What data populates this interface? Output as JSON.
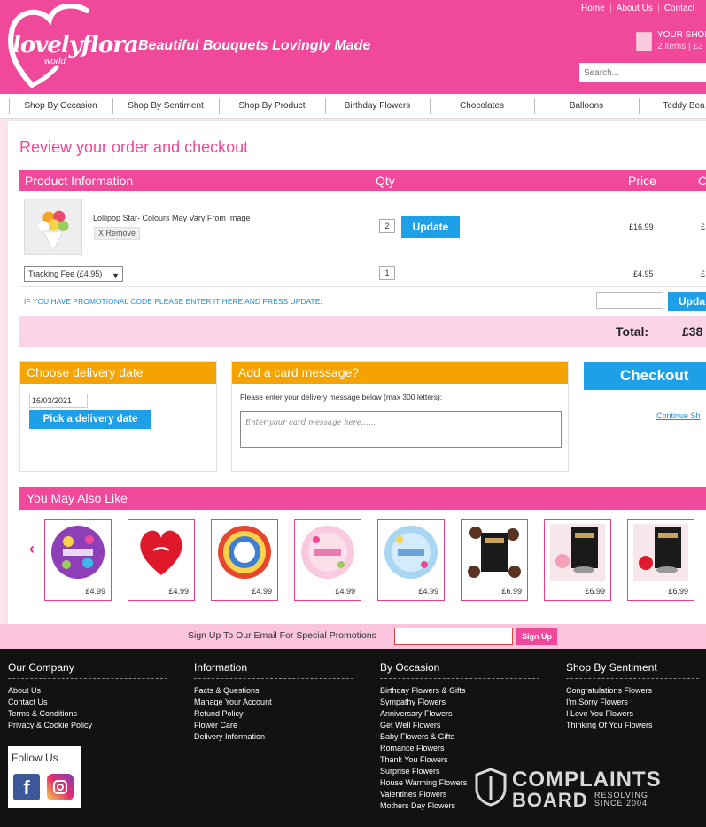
{
  "header": {
    "logo_text": "lovelyflora",
    "logo_sub": "world",
    "tagline": "Beautiful Bouquets Lovingly Made",
    "topnav": [
      "Home",
      "About Us",
      "Contact"
    ],
    "basket_title": "YOUR SHOP",
    "basket_items": "2 items  |  £3",
    "search_placeholder": "Search..."
  },
  "nav": [
    "Shop By Occasion",
    "Shop By Sentiment",
    "Shop By Product",
    "Birthday Flowers",
    "Chocolates",
    "Balloons",
    "Teddy Bea"
  ],
  "cart": {
    "page_title": "Review your order and checkout",
    "col_product": "Product Information",
    "col_qty": "Qty",
    "col_price": "Price",
    "col_total": "C",
    "product_name": "Lollipop Star- Colours May Vary From Image",
    "remove_label": "X Remove",
    "product_qty": "2",
    "update_label": "Update",
    "product_price": "£16.99",
    "product_total": "£",
    "tracking_label": "Tracking Fee (£4.95)",
    "tracking_qty": "1",
    "tracking_price": "£4.95",
    "tracking_total": "£",
    "promo_text": "IF YOU HAVE PROMOTIONAL CODE PLEASE ENTER IT HERE AND PRESS UPDATE:",
    "promo_update_label": "Upda",
    "total_label": "Total:",
    "total_value": "£38"
  },
  "delivery": {
    "heading": "Choose delivery date",
    "date_value": "16/03/2021",
    "pick_label": "Pick a delivery date"
  },
  "card_message": {
    "heading": "Add a card message?",
    "instructions": "Please enter your delivery message below (max 300 letters):",
    "placeholder": "Enter your card message here......"
  },
  "checkout": {
    "button_label": "Checkout",
    "continue_label": "Continue Sh"
  },
  "also_like": {
    "heading": "You May Also Like",
    "items": [
      {
        "name": "happy-birthday-balloon",
        "price": "£4.99"
      },
      {
        "name": "heart-balloon",
        "price": "£4.99"
      },
      {
        "name": "thank-you-balloon",
        "price": "£4.99"
      },
      {
        "name": "baby-girl-balloon",
        "price": "£4.99"
      },
      {
        "name": "baby-boy-balloon",
        "price": "£4.99"
      },
      {
        "name": "beechs-chocolates-1",
        "price": "£6.99"
      },
      {
        "name": "beechs-chocolates-2",
        "price": "£6.99"
      },
      {
        "name": "beechs-chocolates-3",
        "price": "£6.99"
      }
    ]
  },
  "signup": {
    "text": "Sign Up To Our Email For Special Promotions",
    "button_label": "Sign Up"
  },
  "footer": {
    "columns": [
      {
        "title": "Our Company",
        "links": [
          "About Us",
          "Contact Us",
          "Terms & Conditions",
          "Privacy & Cookie Policy"
        ]
      },
      {
        "title": "Information",
        "links": [
          "Facts & Questions",
          "Manage Your Account",
          "Refund Policy",
          "Flower Care",
          "Delivery Information"
        ]
      },
      {
        "title": "By Occasion",
        "links": [
          "Birthday Flowers & Gifts",
          "Sympathy Flowers",
          "Anniversary Flowers",
          "Get Well Flowers",
          "Baby Flowers & Gifts",
          "Romance Flowers",
          "Thank You Flowers",
          "Surprise Flowers",
          "House Warming Flowers",
          "Valentines Flowers",
          "Mothers Day Flowers"
        ]
      },
      {
        "title": "Shop By Sentiment",
        "links": [
          "Congratulations Flowers",
          "I'm Sorry Flowers",
          "I Love You Flowers",
          "Thinking Of You Flowers"
        ]
      }
    ],
    "follow_label": "Follow Us"
  },
  "watermark": {
    "line1": "COMPLAINTS",
    "line2": "BOARD",
    "line3a": "RESOLVING",
    "line3b": "SINCE 2004"
  },
  "colors": {
    "brand_pink": "#f0489a",
    "accent_blue": "#1ea0e8",
    "orange": "#f5a300"
  }
}
